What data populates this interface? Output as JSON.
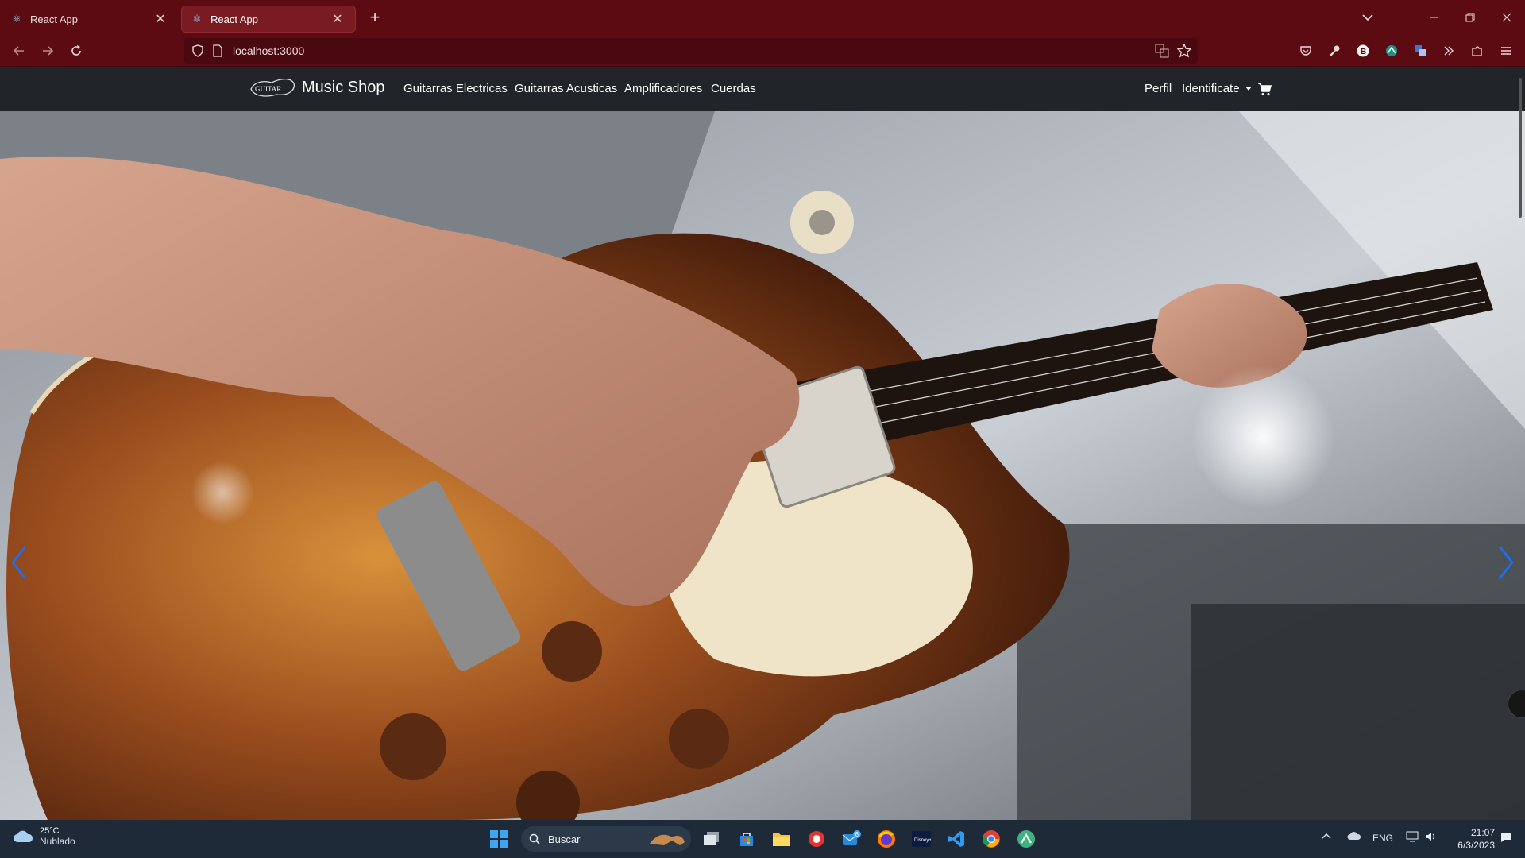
{
  "browser": {
    "tabs": [
      {
        "title": "React App",
        "active": false
      },
      {
        "title": "React App",
        "active": true
      }
    ],
    "url": "localhost:3000"
  },
  "site": {
    "logo_text": "GUITAR",
    "brand": "Music Shop",
    "nav_links": [
      "Guitarras Electricas",
      "Guitarras Acusticas",
      "Amplificadores",
      "Cuerdas"
    ],
    "right_links": {
      "profile": "Perfil",
      "login": "Identificate"
    }
  },
  "carousel": {
    "slide_image": "electric-guitar-closeup-photo"
  },
  "taskbar": {
    "weather": {
      "temp": "25°C",
      "condition": "Nublado"
    },
    "search_label": "Buscar",
    "language": "ENG",
    "time": "21:07",
    "date": "6/3/2023",
    "mail_badge": "6"
  },
  "colors": {
    "browser_chrome": "#5c0b12",
    "site_navbar": "#212529",
    "carousel_arrow": "#1e6fe8",
    "taskbar": "#1f2a38"
  }
}
